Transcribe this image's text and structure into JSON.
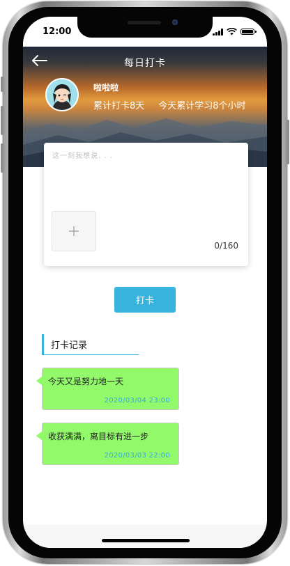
{
  "status_bar": {
    "time": "12:00"
  },
  "header": {
    "title": "每日打卡",
    "username": "啦啦啦",
    "total_days": "累计打卡8天",
    "today_hours": "今天累计学习8个小时"
  },
  "checkin_form": {
    "placeholder": "这一刻我想说. . .",
    "counter": "0/160",
    "submit_label": "打卡"
  },
  "records": {
    "title": "打卡记录",
    "items": [
      {
        "content": "今天又是努力地一天",
        "date": "2020/03/04  23:00"
      },
      {
        "content": "收获满满，离目标有进一步",
        "date": "2020/03/03  22:00"
      }
    ]
  },
  "colors": {
    "accent": "#38b3dd",
    "bubble": "#92f96a",
    "date_text": "#3aa9df"
  },
  "icons": [
    "back-arrow-icon",
    "plus-icon",
    "signal-icon",
    "wifi-icon",
    "battery-icon"
  ]
}
